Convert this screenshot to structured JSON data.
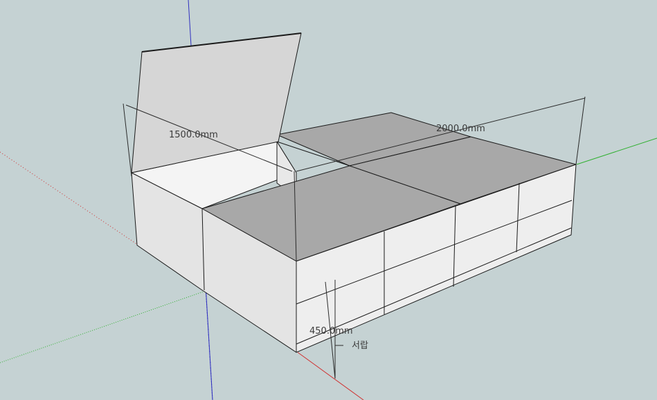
{
  "scene": {
    "background_color": "#c5d2d3",
    "axis_colors": {
      "red": "#d03030",
      "green": "#30b030",
      "blue": "#3030c0"
    }
  },
  "dimensions": {
    "width_label": "1500.0mm",
    "length_label": "2000.0mm",
    "height_label": "450.0mm"
  },
  "annotations": {
    "drawer_label": "서랍"
  },
  "colors": {
    "top_face": "#a8a8a8",
    "side_face": "#e6e6e6",
    "front_face": "#ececec",
    "lid_face": "#d8d8d8",
    "edge": "#1a1a1a"
  }
}
